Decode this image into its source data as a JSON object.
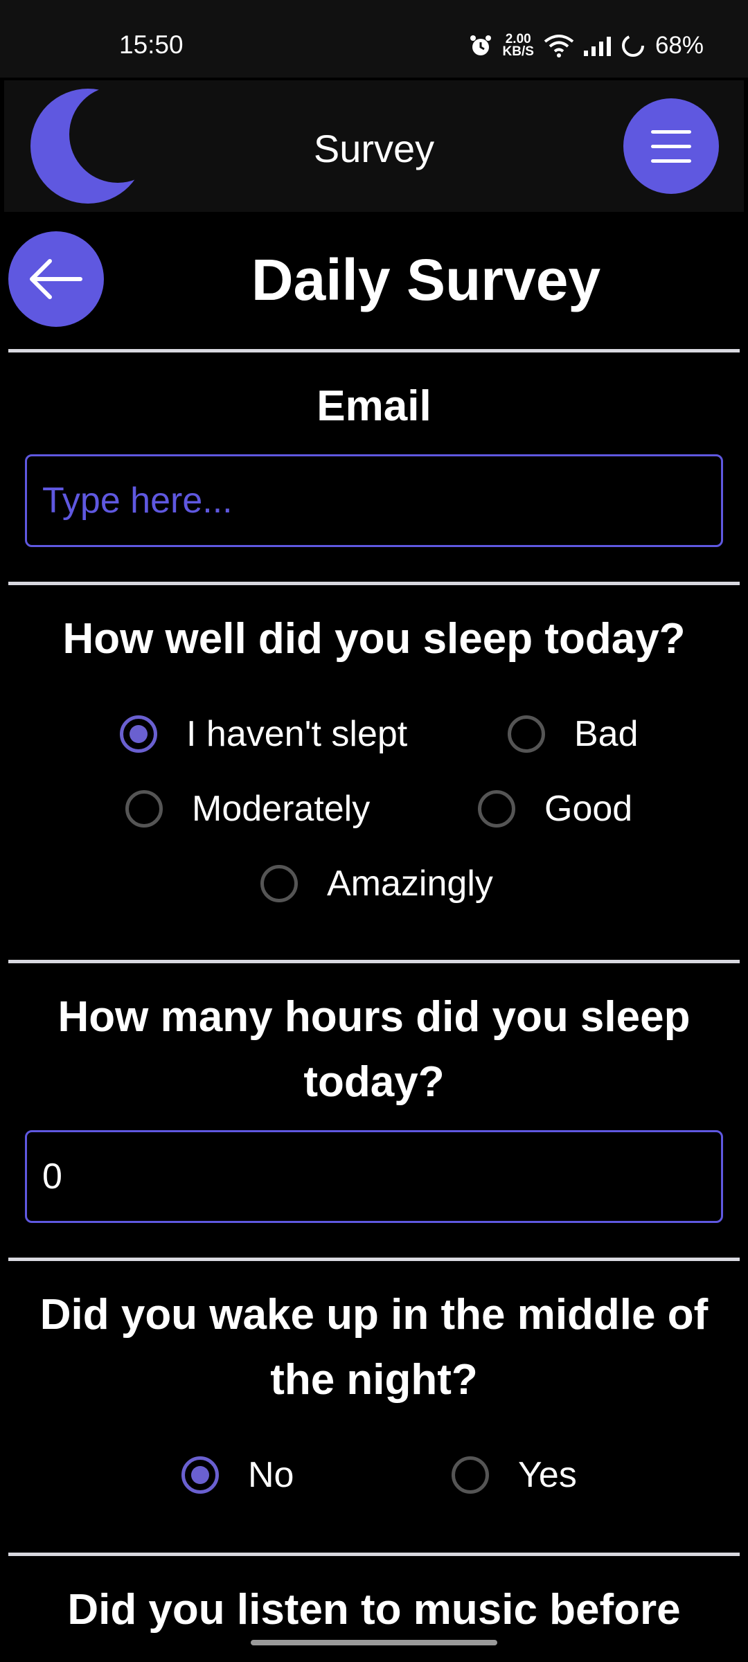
{
  "status_bar": {
    "time": "15:50",
    "net_speed_value": "2.00",
    "net_speed_unit": "KB/S",
    "battery": "68%"
  },
  "app_bar": {
    "title": "Survey",
    "logo_icon": "moon-icon",
    "menu_icon": "hamburger-menu-icon"
  },
  "page": {
    "title": "Daily Survey",
    "back_icon": "arrow-left-icon"
  },
  "email": {
    "label": "Email",
    "placeholder": "Type here...",
    "value": ""
  },
  "sleep_quality": {
    "label": "How well did you sleep today?",
    "options": [
      "I haven't slept",
      "Bad",
      "Moderately",
      "Good",
      "Amazingly"
    ],
    "selected": "I haven't slept"
  },
  "sleep_hours": {
    "label_line1": "How many hours did you sleep",
    "label_line2": "today?",
    "value": "0"
  },
  "woke_up": {
    "label_line1": "Did you wake up in the middle of",
    "label_line2": "the night?",
    "options": [
      "No",
      "Yes"
    ],
    "selected": "No"
  },
  "music": {
    "label_line1": "Did you listen to music before"
  },
  "colors": {
    "accent": "#5f58e0",
    "radio_checked": "#6a60d0",
    "background": "#000000",
    "app_bar": "#0f0f0f"
  }
}
